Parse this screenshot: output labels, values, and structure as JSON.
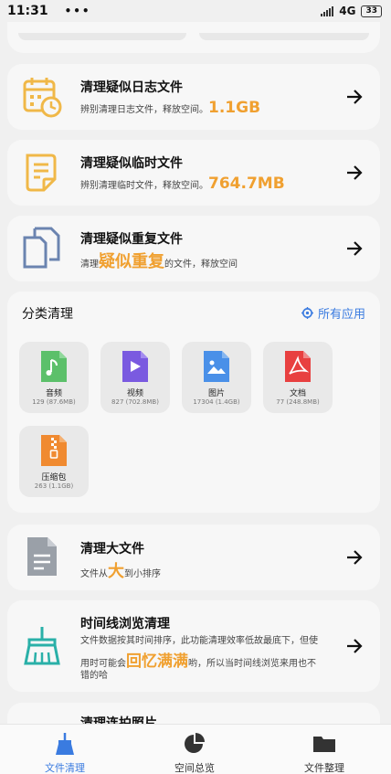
{
  "status": {
    "time": "11:31",
    "dots": "•••",
    "network": "4G",
    "battery": "33"
  },
  "rows": [
    {
      "title": "清理疑似日志文件",
      "sub_prefix": "辨别清理日志文件，释放空间。",
      "sub_value": "1.1GB",
      "icon": "log-calendar-icon"
    },
    {
      "title": "清理疑似临时文件",
      "sub_prefix": "辨别清理临时文件，释放空间。",
      "sub_value": "764.7MB",
      "icon": "temp-document-icon"
    },
    {
      "title": "清理疑似重复文件",
      "sub_prefix": "清理",
      "sub_highlight": "疑似重复",
      "sub_suffix": "的文件，释放空间",
      "icon": "duplicate-files-icon"
    }
  ],
  "category": {
    "title": "分类清理",
    "all_apps": "所有应用",
    "tiles": [
      {
        "label": "音频",
        "count": "129 (87.6MB)",
        "color": "#5cc06a"
      },
      {
        "label": "视频",
        "count": "827 (702.8MB)",
        "color": "#7a5ae0"
      },
      {
        "label": "图片",
        "count": "17304 (1.4GB)",
        "color": "#4a90e8"
      },
      {
        "label": "文档",
        "count": "77 (248.8MB)",
        "color": "#e84040"
      },
      {
        "label": "压缩包",
        "count": "263 (1.1GB)",
        "color": "#f08a30"
      }
    ]
  },
  "big_files": {
    "title": "清理大文件",
    "sub_prefix": "文件从",
    "sub_highlight": "大",
    "sub_suffix": "到小排序"
  },
  "timeline": {
    "title": "时间线浏览清理",
    "line1": "文件数据按其时间排序，此功能清理效率低故最底下，但使",
    "line2_prefix": "用时可能会",
    "line2_highlight": "回忆满满",
    "line2_suffix": "哟，所以当时间线浏览来用也不",
    "line3": "错的哈"
  },
  "partial_card": {
    "title": "清理连拍照片"
  },
  "nav": [
    {
      "label": "文件清理",
      "active": true
    },
    {
      "label": "空间总览",
      "active": false
    },
    {
      "label": "文件整理",
      "active": false
    }
  ],
  "colors": {
    "accent": "#3a7be0",
    "highlight": "#f0a030"
  }
}
